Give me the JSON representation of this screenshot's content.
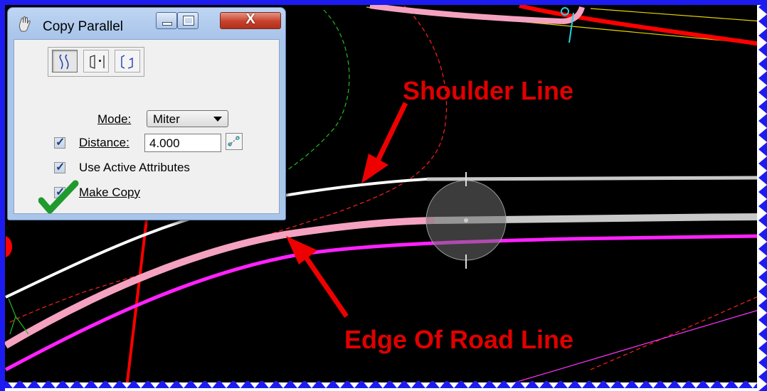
{
  "dialog": {
    "title": "Copy Parallel",
    "app_icon": "hand-icon",
    "buttons": [
      "minimize",
      "maximize",
      "close"
    ],
    "tools": [
      {
        "name": "copy-parallel-by-distance-tool",
        "active": true
      },
      {
        "name": "copy-parallel-by-point-tool",
        "active": false
      },
      {
        "name": "copy-parallel-by-key-in-tool",
        "active": false
      }
    ],
    "mode_label": "Mode:",
    "mode_value": "Miter",
    "distance_label": "Distance:",
    "distance_value": "4.000",
    "distance_checked": true,
    "use_active_attributes_label": "Use Active Attributes",
    "use_active_attributes_checked": true,
    "make_copy_label": "Make Copy",
    "make_copy_checked": true
  },
  "annotations": {
    "shoulder_label": "Shoulder Line",
    "edge_label": "Edge Of Road Line",
    "text_color": "#e00000",
    "checkmark_color": "#1f9a2c"
  },
  "colors": {
    "canvas_background": "#000000",
    "white_line": "#ffffff",
    "pink_line": "#f4a2c0",
    "magenta_line": "#ff22ff",
    "red_line": "#ff0000",
    "frame_edge": "#1a1aee"
  }
}
